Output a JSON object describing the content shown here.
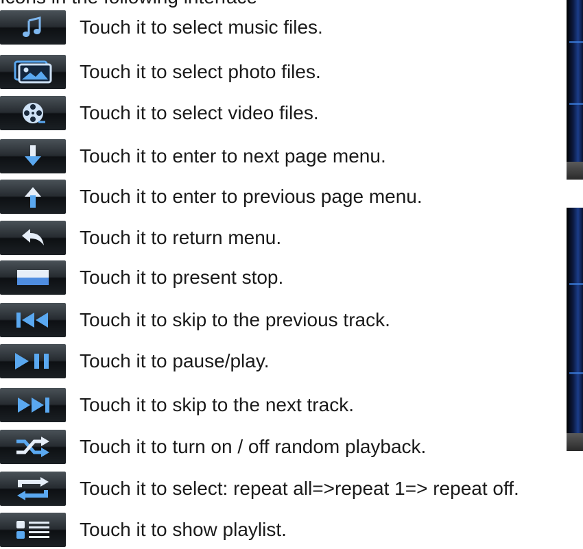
{
  "intro_text": "Icons in the following interface",
  "items": [
    {
      "icon": "music-note-icon",
      "label": "Touch it to select music files."
    },
    {
      "icon": "photo-icon",
      "label": "Touch it to select photo files."
    },
    {
      "icon": "film-reel-icon",
      "label": "Touch it to select video files."
    },
    {
      "icon": "arrow-down-icon",
      "label": "Touch it to enter to next page menu."
    },
    {
      "icon": "arrow-up-icon",
      "label": "Touch it to enter to previous page menu."
    },
    {
      "icon": "return-arrow-icon",
      "label": "Touch it to return menu."
    },
    {
      "icon": "stop-icon",
      "label": "Touch it to present stop."
    },
    {
      "icon": "previous-track-icon",
      "label": "Touch it to skip to the previous track."
    },
    {
      "icon": "play-pause-icon",
      "label": "Touch it to pause/play."
    },
    {
      "icon": "next-track-icon",
      "label": "Touch it to skip to the next track."
    },
    {
      "icon": "shuffle-icon",
      "label": "Touch it to turn on / off random playback."
    },
    {
      "icon": "repeat-icon",
      "label": "Touch it to select: repeat all=>repeat 1=> repeat off."
    },
    {
      "icon": "playlist-icon",
      "label": "Touch it to show playlist."
    }
  ],
  "colors": {
    "button_top": "#4a5258",
    "button_bottom": "#0d1013",
    "icon_blue": "#5aa8f0",
    "icon_white": "#e6eef8"
  }
}
